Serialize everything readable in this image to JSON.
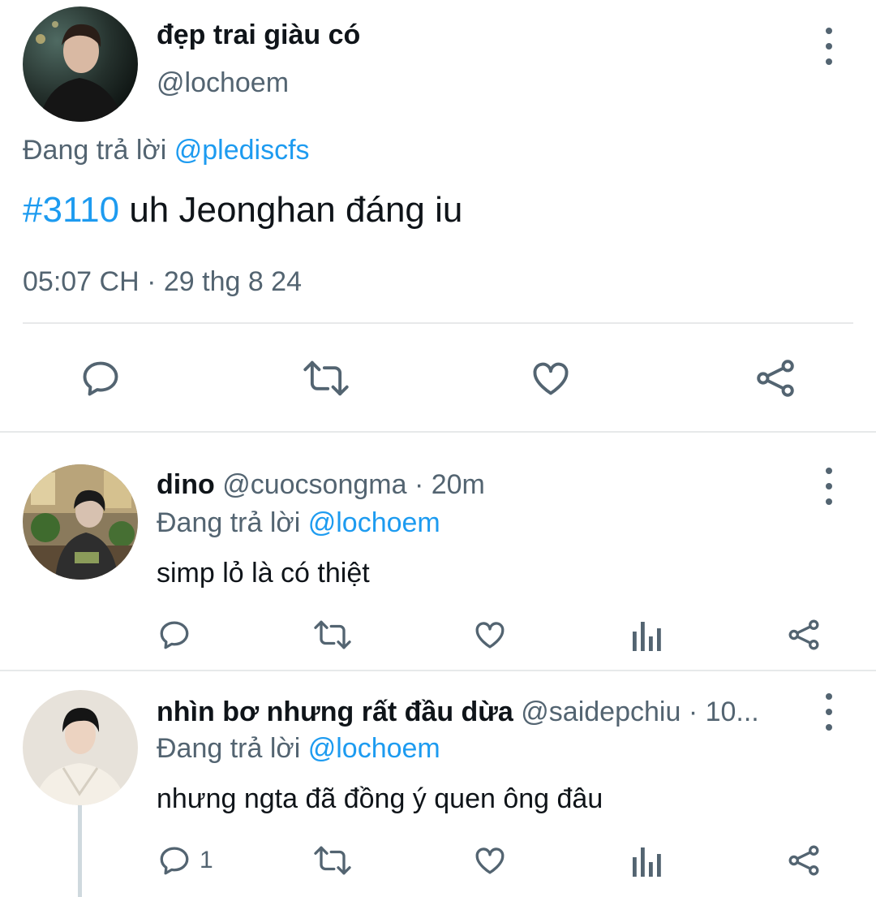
{
  "main_tweet": {
    "display_name": "đẹp trai giàu có",
    "handle": "@lochoem",
    "replying_prefix": "Đang trả lời",
    "replying_to": "@plediscfs",
    "hashtag": "#3110",
    "text": " uh Jeonghan đáng iu",
    "timestamp": "05:07 CH · 29 thg 8 24",
    "actions": [
      "reply-icon",
      "retweet-icon",
      "like-icon",
      "share-icon"
    ]
  },
  "replies": [
    {
      "display_name": "dino",
      "handle": "@cuocsongma",
      "time": "· 20m",
      "replying_prefix": "Đang trả lời",
      "replying_to": "@lochoem",
      "text": "simp lỏ là có thiệt",
      "reply_count": ""
    },
    {
      "display_name": "nhìn bơ nhưng rất đầu dừa",
      "handle": "@saidepchiu",
      "time": "· 10...",
      "replying_prefix": "Đang trả lời",
      "replying_to": "@lochoem",
      "text": "nhưng ngta đã đồng ý quen ông đâu",
      "reply_count": "1"
    }
  ],
  "colors": {
    "accent": "#1d9bf0",
    "muted": "#536471",
    "divider": "#e7e9ea"
  }
}
